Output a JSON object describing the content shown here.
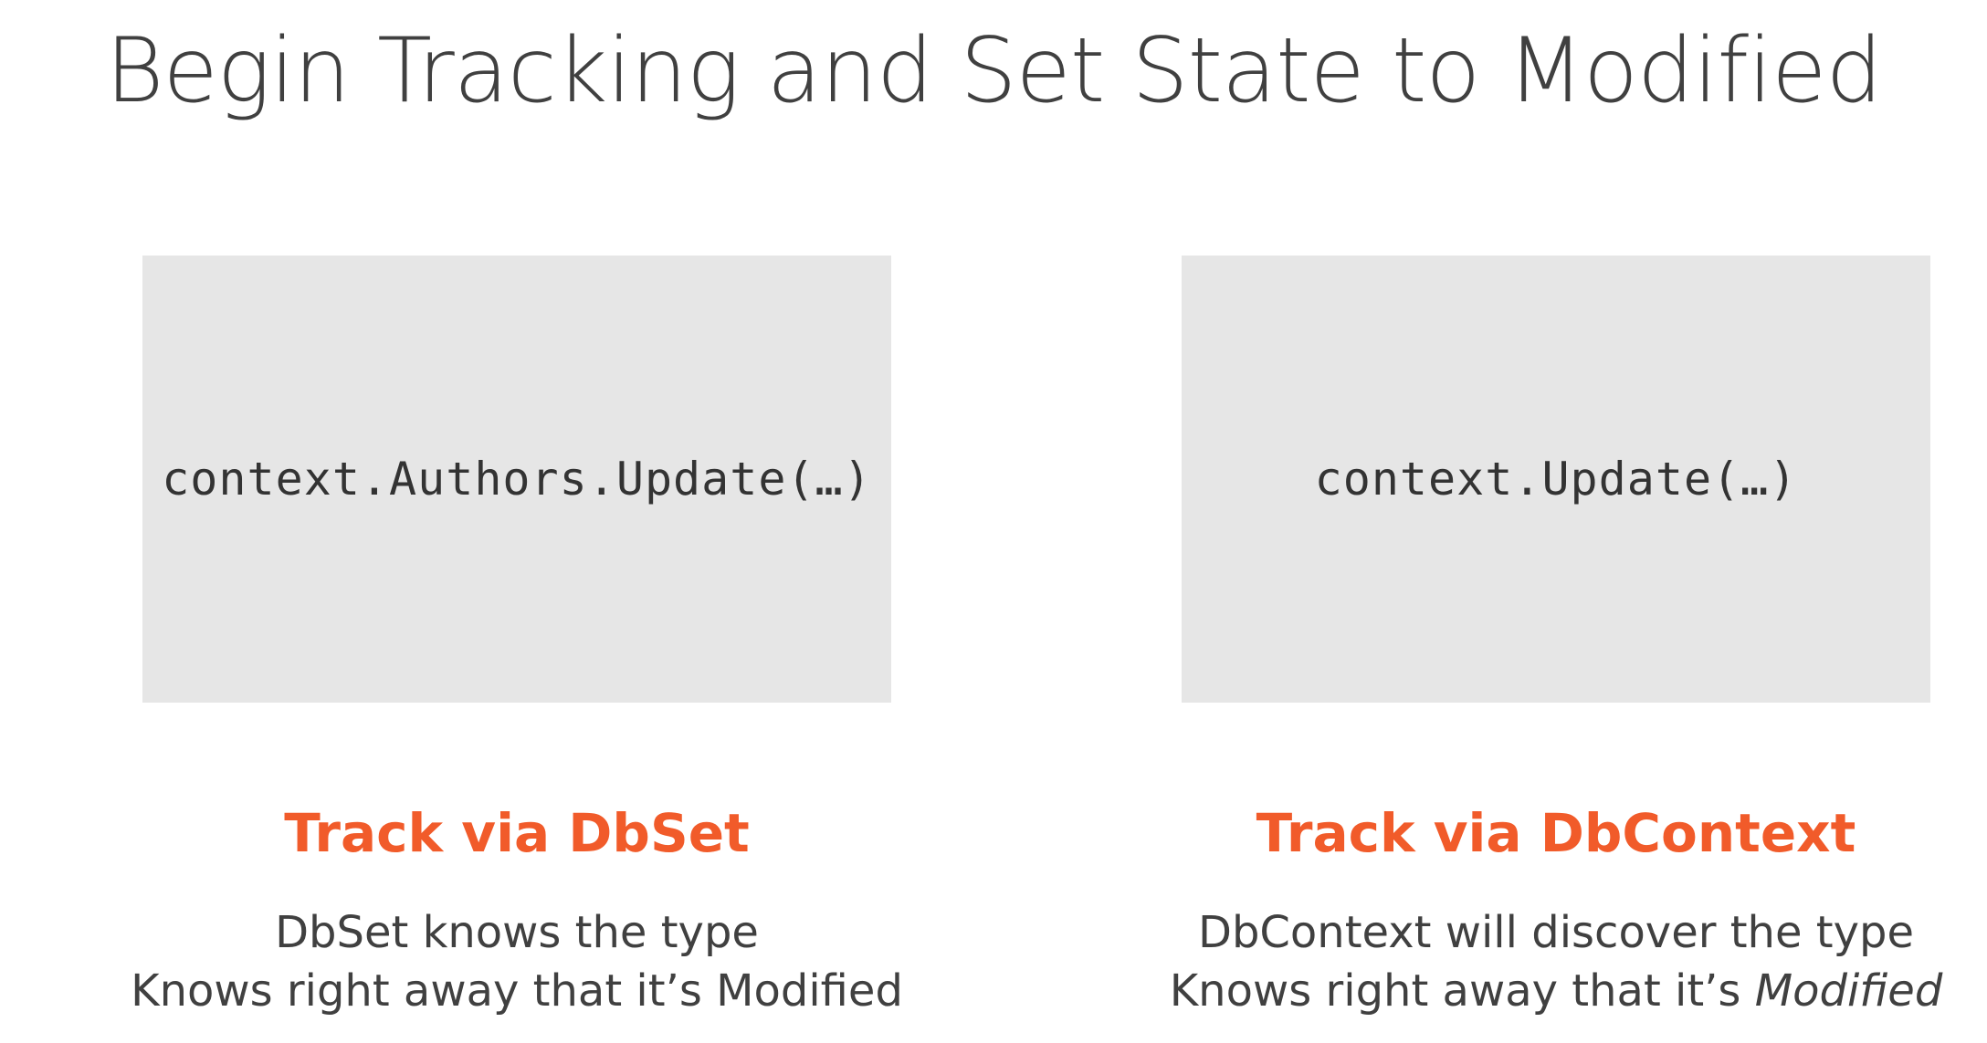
{
  "slide": {
    "title": "Begin Tracking and Set State to Modified"
  },
  "columns": {
    "left": {
      "code": "context.Authors.Update(…)",
      "heading": "Track via DbSet",
      "line1": "DbSet knows the type",
      "line2": "Knows right away that it’s Modified"
    },
    "right": {
      "code": "context.Update(…)",
      "heading": "Track via DbContext",
      "line1": "DbContext will discover the type",
      "line2_prefix": "Knows right away that it’s ",
      "line2_emphasis": "Modified"
    }
  },
  "colors": {
    "accent": "#f15b2a",
    "code_box": "#e6e6e6",
    "text": "#404040"
  }
}
